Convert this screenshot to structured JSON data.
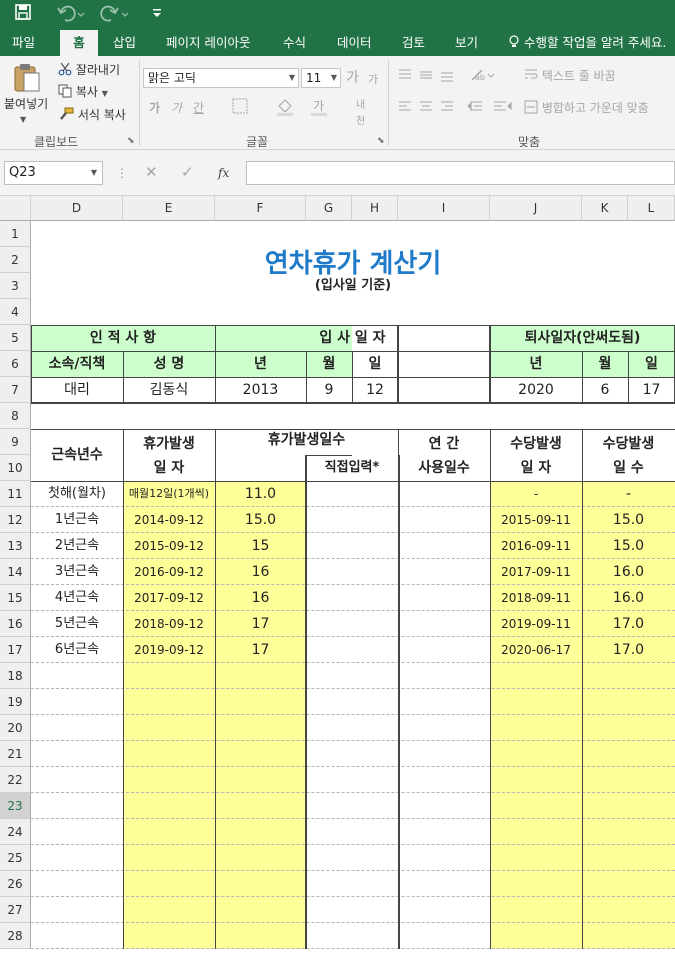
{
  "app": {
    "accent": "#217346",
    "sheet_bg_yellow": "#ffff99",
    "header_green": "#ccffcc",
    "title_color": "#1f7ac8"
  },
  "qat": {
    "icons": [
      "save-icon",
      "undo-icon",
      "redo-icon",
      "customize-icon"
    ]
  },
  "tabs": [
    "파일",
    "홈",
    "삽입",
    "페이지 레이아웃",
    "수식",
    "데이터",
    "검토",
    "보기"
  ],
  "tell_me": "수행할 작업을 알려 주세요.",
  "ribbon": {
    "clipboard": {
      "paste": "붙여넣기",
      "cut": "잘라내기",
      "copy": "복사",
      "format_painter": "서식 복사",
      "group": "클립보드"
    },
    "font": {
      "name": "맑은 고딕",
      "size": "11",
      "bold": "가",
      "italic": "가",
      "underline": "간",
      "size_up": "가",
      "size_down": "가",
      "group": "글꼴"
    },
    "align": {
      "wrap": "텍스트 줄 바꿈",
      "merge": "병합하고 가운데 맞춤",
      "group": "맞춤"
    }
  },
  "formula_bar": {
    "name_box": "Q23",
    "fx": "fx",
    "value": ""
  },
  "columns": [
    "D",
    "E",
    "F",
    "G",
    "H",
    "I",
    "J",
    "K",
    "L"
  ],
  "rows": [
    "1",
    "2",
    "3",
    "4",
    "5",
    "6",
    "7",
    "8",
    "9",
    "10",
    "11",
    "12",
    "13",
    "14",
    "15",
    "16",
    "17",
    "18",
    "19",
    "20",
    "21",
    "22",
    "23",
    "24",
    "25",
    "26",
    "27",
    "28"
  ],
  "sheet": {
    "title": "연차휴가 계산기",
    "subtitle": "(입사일 기준)",
    "personal_header": "인 적 사 항",
    "join_header": "입 사 일 자",
    "retire_header": "퇴사일자(안써도됨)",
    "dept_label": "소속/직책",
    "name_label": "성  명",
    "year_label": "년",
    "month_label": "월",
    "day_label": "일",
    "dept_value": "대리",
    "name_value": "김동식",
    "join_year": "2013",
    "join_month": "9",
    "join_day": "12",
    "retire_year": "2020",
    "retire_month": "6",
    "retire_day": "17",
    "h_years": "근속년수",
    "h_leave_date_1": "휴가발생",
    "h_leave_date_2": "일    자",
    "h_leave_days": "휴가발생일수",
    "h_direct": "직접입력*",
    "h_annual_1": "연     간",
    "h_annual_2": "사용일수",
    "h_allow_date_1": "수당발생",
    "h_allow_date_2": "일    자",
    "h_allow_days_1": "수당발생",
    "h_allow_days_2": "일    수",
    "data_rows": [
      {
        "years": "첫해(월차)",
        "date": "매월12일(1개씩)",
        "days": "11.0",
        "allow_date": "-",
        "allow_days": "-"
      },
      {
        "years": "1년근속",
        "date": "2014-09-12",
        "days": "15.0",
        "allow_date": "2015-09-11",
        "allow_days": "15.0"
      },
      {
        "years": "2년근속",
        "date": "2015-09-12",
        "days": "15",
        "allow_date": "2016-09-11",
        "allow_days": "15.0"
      },
      {
        "years": "3년근속",
        "date": "2016-09-12",
        "days": "16",
        "allow_date": "2017-09-11",
        "allow_days": "16.0"
      },
      {
        "years": "4년근속",
        "date": "2017-09-12",
        "days": "16",
        "allow_date": "2018-09-11",
        "allow_days": "16.0"
      },
      {
        "years": "5년근속",
        "date": "2018-09-12",
        "days": "17",
        "allow_date": "2019-09-11",
        "allow_days": "17.0"
      },
      {
        "years": "6년근속",
        "date": "2019-09-12",
        "days": "17",
        "allow_date": "2020-06-17",
        "allow_days": "17.0"
      }
    ]
  }
}
